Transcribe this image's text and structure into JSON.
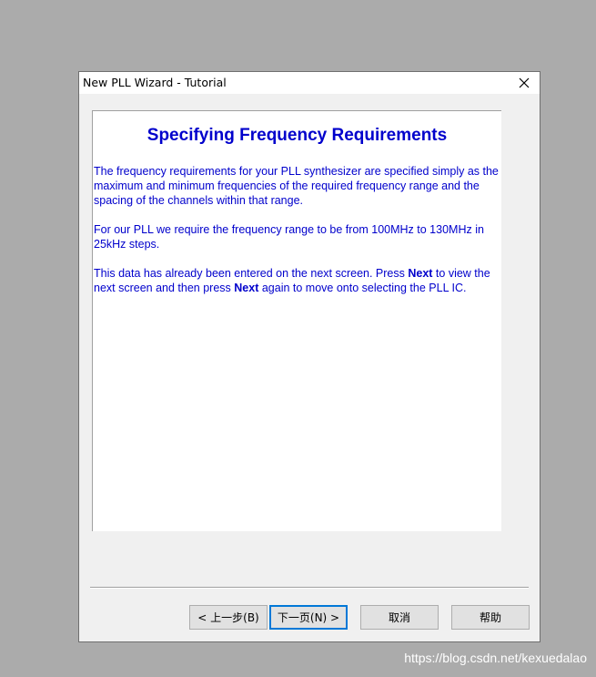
{
  "window": {
    "title": "New PLL Wizard - Tutorial",
    "close_icon": "close-icon"
  },
  "content": {
    "heading": "Specifying Frequency Requirements",
    "paragraph1": "The frequency requirements for your PLL synthesizer are specified simply as the maximum and minimum frequencies of the required frequency range and the spacing of the channels within that range.",
    "paragraph2": "For our PLL we require the frequency range to be from 100MHz to 130MHz in 25kHz steps.",
    "paragraph3": {
      "part1": "This data has already been entered on the next screen.   Press ",
      "bold1": "Next",
      "part2": " to view the next screen and then press ",
      "bold2": "Next",
      "part3": " again to move onto selecting the PLL IC."
    }
  },
  "buttons": {
    "back": "< 上一步(B)",
    "next": "下一页(N) >",
    "cancel": "取消",
    "help": "帮助"
  },
  "watermark": "https://blog.csdn.net/kexuedalao",
  "colors": {
    "text_blue": "#0000cc",
    "focus_blue": "#0078d7",
    "desktop_gray": "#ababab"
  }
}
